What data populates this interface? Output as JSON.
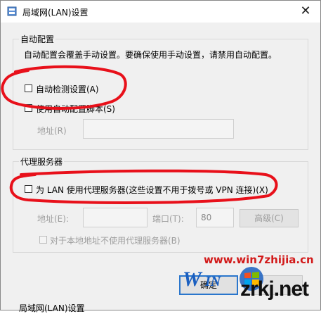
{
  "window": {
    "title": "局域网(LAN)设置",
    "close_glyph": "✕"
  },
  "auto_config": {
    "group_title": "自动配置",
    "description": "自动配置会覆盖手动设置。要确保使用手动设置，请禁用自动配置。",
    "auto_detect_label": "自动检测设置(A)",
    "auto_detect_checked": false,
    "script_label": "使用自动配置脚本(S)",
    "script_checked": false,
    "address_label": "地址(R)",
    "address_value": ""
  },
  "proxy": {
    "group_title": "代理服务器",
    "use_proxy_label": "为 LAN 使用代理服务器(这些设置不用于拨号或 VPN 连接)(X)",
    "use_proxy_checked": false,
    "address_label": "地址(E):",
    "address_value": "",
    "port_label": "端口(T):",
    "port_value": "80",
    "advanced_label": "高级(C)",
    "bypass_label": "对于本地地址不使用代理服务器(B)",
    "bypass_checked": false
  },
  "buttons": {
    "ok_label": "确定"
  },
  "background_title": "局域网(LAN)设置",
  "watermarks": {
    "site1": "www.win7zhijia.cn",
    "site2": "zrkj.net"
  },
  "colors": {
    "annotation_red": "#e8101a",
    "ok_border": "#2a76cc",
    "watermark_red": "#d21a1a",
    "watermark_blue": "#1a5fc0"
  },
  "icons": [
    "app-icon",
    "close-icon",
    "windows-logo-icon"
  ]
}
